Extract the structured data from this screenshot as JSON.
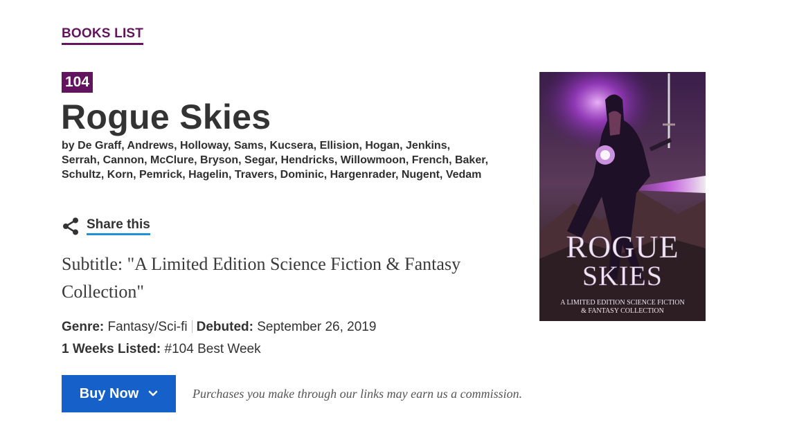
{
  "nav": {
    "books_list": "BOOKS LIST"
  },
  "book": {
    "rank": "104",
    "title": "Rogue Skies",
    "authors": "by De Graff, Andrews, Holloway, Sams, Kucsera, Ellision, Hogan, Jenkins, Serrah, Cannon, McClure, Bryson, Segar, Hendricks, Willowmoon, French, Baker, Schultz, Korn, Pemrick, Hagelin, Travers, Dominic, Hargenrader, Nugent, Vedam",
    "subtitle": "Subtitle: \"A Limited Edition Science Fiction & Fantasy Collection\"",
    "genre_label": "Genre:",
    "genre": "Fantasy/Sci-fi",
    "debuted_label": "Debuted:",
    "debuted": "September 26, 2019",
    "weeks_label": "1 Weeks Listed:",
    "best_week": "#104 Best Week"
  },
  "share": {
    "label": "Share this",
    "icon": "share-icon"
  },
  "buy": {
    "label": "Buy Now",
    "icon": "chevron-down-icon"
  },
  "disclaimer": "Purchases you make through our links may earn us a commission.",
  "cover": {
    "title_line1": "ROGUE",
    "title_line2": "SKIES",
    "tagline_line1": "A LIMITED EDITION SCIENCE FICTION",
    "tagline_line2": "& FANTASY COLLECTION"
  },
  "colors": {
    "brand": "#63145e",
    "button": "#1660c9",
    "share_underline": "#1e90d6"
  }
}
